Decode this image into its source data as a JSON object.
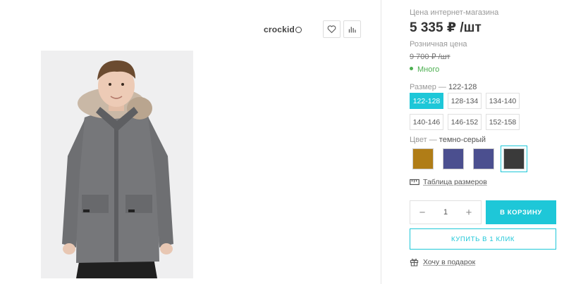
{
  "brand": {
    "name": "crockid"
  },
  "gallery": {
    "favorite_icon": "heart-icon",
    "compare_icon": "bar-chart-icon",
    "photo_alt": ""
  },
  "pricing": {
    "online_label": "Цена интернет-магазина",
    "online_price": "5 335 ₽ /шт",
    "retail_label": "Розничная цена",
    "retail_price": "9 700 ₽ /шт",
    "stock_status": "Много"
  },
  "size_selector": {
    "label": "Размер",
    "dash": "—",
    "selected": "122-128",
    "options": [
      "122-128",
      "128-134",
      "134-140",
      "140-146",
      "146-152",
      "152-158"
    ]
  },
  "color_selector": {
    "label": "Цвет",
    "dash": "—",
    "selected": "темно-серый",
    "swatches": [
      "#b07d17",
      "#4b4f8f",
      "#4b4f8f",
      "#3a3a3a"
    ]
  },
  "size_table_link": "Таблица размеров",
  "cart": {
    "quantity": "1",
    "minus": "−",
    "plus": "+",
    "add_to_cart": "В КОРЗИНУ",
    "buy_one_click": "КУПИТЬ В 1 КЛИК"
  },
  "gift_link": "Хочу в подарок",
  "colors": {
    "accent": "#1ec7d8",
    "stock": "#4caf50"
  }
}
